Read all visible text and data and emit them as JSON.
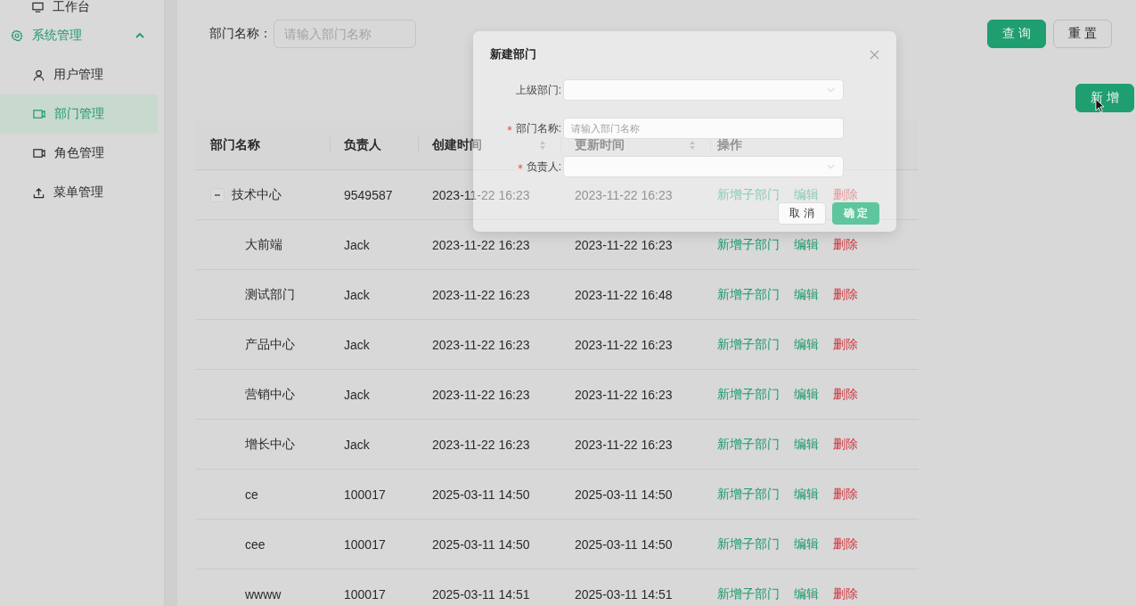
{
  "sidebar": {
    "items": [
      {
        "label": "工作台",
        "kind": "item",
        "selected": false
      },
      {
        "label": "系统管理",
        "kind": "group",
        "expanded": true,
        "children": [
          {
            "label": "用户管理",
            "selected": false
          },
          {
            "label": "部门管理",
            "selected": true
          },
          {
            "label": "角色管理",
            "selected": false
          },
          {
            "label": "菜单管理",
            "selected": false
          }
        ]
      }
    ]
  },
  "filter": {
    "label": "部门名称：",
    "placeholder": "请输入部门名称"
  },
  "filter_buttons": [
    {
      "label": "查 询",
      "kind": "primary"
    },
    {
      "label": "重 置",
      "kind": "default"
    }
  ],
  "add_button": {
    "label": "新 增"
  },
  "table": {
    "columns": [
      {
        "label": "部门名称",
        "sortable": false
      },
      {
        "label": "负责人",
        "sortable": false
      },
      {
        "label": "创建时间",
        "sortable": true
      },
      {
        "label": "更新时间",
        "sortable": true
      },
      {
        "label": "操作",
        "sortable": false
      }
    ],
    "rows": [
      {
        "name": "技术中心",
        "owner": "9549587",
        "created": "2023-11-22 16:23",
        "updated": "2023-11-22 16:23",
        "expanded": true,
        "actions": [
          {
            "label": "新增子部门",
            "kind": "link"
          },
          {
            "label": "编辑",
            "kind": "link"
          },
          {
            "label": "删除",
            "kind": "danger"
          }
        ],
        "children": [
          {
            "name": "大前端",
            "owner": "Jack",
            "created": "2023-11-22 16:23",
            "updated": "2023-11-22 16:23",
            "actions": [
              {
                "label": "新增子部门",
                "kind": "link"
              },
              {
                "label": "编辑",
                "kind": "link"
              },
              {
                "label": "删除",
                "kind": "danger"
              }
            ]
          },
          {
            "name": "测试部门",
            "owner": "Jack",
            "created": "2023-11-22 16:23",
            "updated": "2023-11-22 16:48",
            "actions": [
              {
                "label": "新增子部门",
                "kind": "link"
              },
              {
                "label": "编辑",
                "kind": "link"
              },
              {
                "label": "删除",
                "kind": "danger"
              }
            ]
          },
          {
            "name": "产品中心",
            "owner": "Jack",
            "created": "2023-11-22 16:23",
            "updated": "2023-11-22 16:23",
            "actions": [
              {
                "label": "新增子部门",
                "kind": "link"
              },
              {
                "label": "编辑",
                "kind": "link"
              },
              {
                "label": "删除",
                "kind": "danger"
              }
            ]
          },
          {
            "name": "营销中心",
            "owner": "Jack",
            "created": "2023-11-22 16:23",
            "updated": "2023-11-22 16:23",
            "actions": [
              {
                "label": "新增子部门",
                "kind": "link"
              },
              {
                "label": "编辑",
                "kind": "link"
              },
              {
                "label": "删除",
                "kind": "danger"
              }
            ]
          },
          {
            "name": "增长中心",
            "owner": "Jack",
            "created": "2023-11-22 16:23",
            "updated": "2023-11-22 16:23",
            "actions": [
              {
                "label": "新增子部门",
                "kind": "link"
              },
              {
                "label": "编辑",
                "kind": "link"
              },
              {
                "label": "删除",
                "kind": "danger"
              }
            ]
          },
          {
            "name": "ce",
            "owner": "100017",
            "created": "2025-03-11 14:50",
            "updated": "2025-03-11 14:50",
            "actions": [
              {
                "label": "新增子部门",
                "kind": "link"
              },
              {
                "label": "编辑",
                "kind": "link"
              },
              {
                "label": "删除",
                "kind": "danger"
              }
            ]
          },
          {
            "name": "cee",
            "owner": "100017",
            "created": "2025-03-11 14:50",
            "updated": "2025-03-11 14:50",
            "actions": [
              {
                "label": "新增子部门",
                "kind": "link"
              },
              {
                "label": "编辑",
                "kind": "link"
              },
              {
                "label": "删除",
                "kind": "danger"
              }
            ]
          },
          {
            "name": "wwww",
            "owner": "100017",
            "created": "2025-03-11 14:51",
            "updated": "2025-03-11 14:51",
            "actions": [
              {
                "label": "新增子部门",
                "kind": "link"
              },
              {
                "label": "编辑",
                "kind": "link"
              },
              {
                "label": "删除",
                "kind": "danger"
              }
            ]
          }
        ]
      }
    ]
  },
  "modal": {
    "title": "新建部门",
    "fields": [
      {
        "label": "上级部门:",
        "kind": "select",
        "required": false
      },
      {
        "label": "部门名称:",
        "kind": "input",
        "required": true,
        "placeholder": "请输入部门名称"
      },
      {
        "label": "负责人:",
        "kind": "select",
        "required": true
      }
    ],
    "buttons": [
      {
        "label": "取 消",
        "kind": "default"
      },
      {
        "label": "确 定",
        "kind": "primary"
      }
    ]
  }
}
